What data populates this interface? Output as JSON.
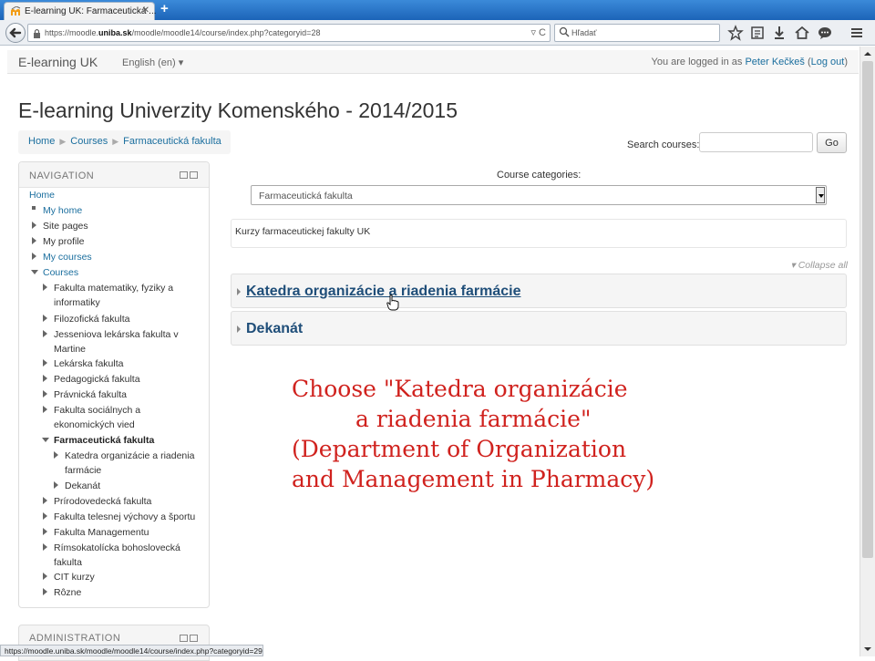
{
  "browser": {
    "tab_title": "E-learning UK: Farmaceutická ...",
    "new_tab": "+",
    "url_prefix": "https://moodle.",
    "url_host": "uniba.sk",
    "url_path": "/moodle/moodle14/course/index.php?categoryid=28",
    "search_placeholder": "Hľadať",
    "status_url": "https://moodle.uniba.sk/moodle/moodle14/course/index.php?categoryid=29"
  },
  "header": {
    "brand": "E-learning UK",
    "language": "English (en)",
    "logged_in_prefix": "You are logged in as ",
    "user_name": "Peter Kečkeš",
    "logout_open": " (",
    "logout": "Log out",
    "logout_close": ")"
  },
  "page_title": "E-learning Univerzity Komenského - 2014/2015",
  "breadcrumb": [
    "Home",
    "Courses",
    "Farmaceutická fakulta"
  ],
  "search": {
    "label": "Search courses:",
    "button": "Go"
  },
  "navigation": {
    "title": "NAVIGATION",
    "home": "Home",
    "items": [
      "My home",
      "Site pages",
      "My profile",
      "My courses",
      "Courses",
      "Fakulta matematiky, fyziky a",
      "informatiky",
      "Filozofická fakulta",
      "Jesseniova lekárska fakulta v",
      "Martine",
      "Lekárska fakulta",
      "Pedagogická fakulta",
      "Právnická fakulta",
      "Fakulta sociálnych a",
      "ekonomických vied",
      "Farmaceutická fakulta",
      "Katedra organizácie a riadenia",
      "farmácie",
      "Dekanát",
      "Prírodovedecká fakulta",
      "Fakulta telesnej výchovy a športu",
      "Fakulta Managementu",
      "Rímsokatolícka bohoslovecká",
      "fakulta",
      "CIT kurzy",
      "Rôzne"
    ]
  },
  "administration": {
    "title": "ADMINISTRATION"
  },
  "main": {
    "category_label": "Course categories:",
    "category_selected": "Farmaceutická fakulta",
    "description": "Kurzy farmaceutickej fakulty UK",
    "collapse_all": "Collapse all",
    "categories": [
      "Katedra organizácie a riadenia farmácie",
      "Dekanát"
    ]
  },
  "annotation": {
    "lines": [
      "Choose \"Katedra organizácie",
      "a riadenia farmácie\"",
      "(Department of Organization",
      "and Management in Pharmacy)"
    ],
    "color": "#d0221e"
  },
  "colors": {
    "link": "#1a6e9e",
    "category_title": "#1f4e79",
    "tabbar": "#2a76cc"
  }
}
